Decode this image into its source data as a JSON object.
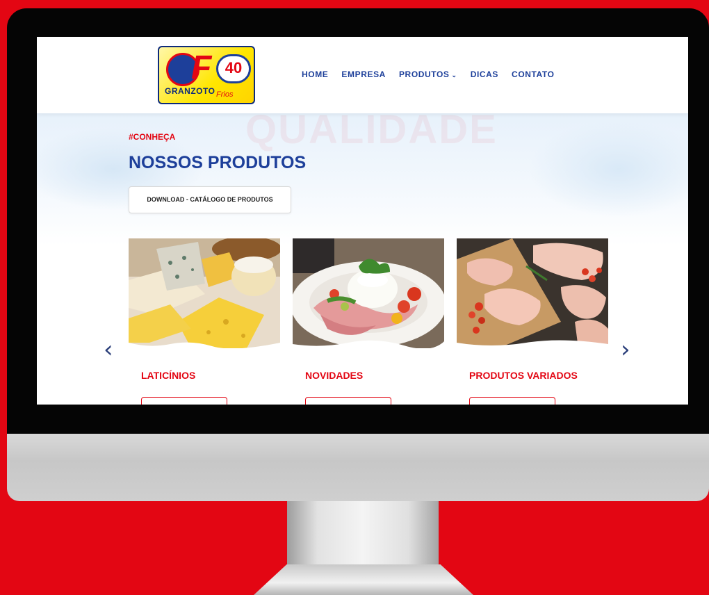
{
  "brand": {
    "logo_name": "GRANZOTO",
    "logo_sub": "Frios",
    "logo_number": "40",
    "logo_letter": "F"
  },
  "nav": {
    "items": [
      {
        "label": "HOME"
      },
      {
        "label": "EMPRESA"
      },
      {
        "label": "PRODUTOS",
        "has_dropdown": true,
        "chevron_icon": "chevron-down-icon"
      },
      {
        "label": "DICAS"
      },
      {
        "label": "CONTATO"
      }
    ]
  },
  "hero": {
    "watermark": "QUALIDADE",
    "eyebrow": "#CONHEÇA",
    "title": "NOSSOS PRODUTOS",
    "download_label": "DOWNLOAD - CATÁLOGO DE PRODUTOS"
  },
  "carousel": {
    "prev_icon": "chevron-left-icon",
    "next_icon": "chevron-right-icon",
    "cards": [
      {
        "title": "LATICÍNIOS",
        "image": "cheese-platter"
      },
      {
        "title": "NOVIDADES",
        "image": "burrata-salad"
      },
      {
        "title": "PRODUTOS VARIADOS",
        "image": "raw-chicken-board"
      }
    ]
  },
  "colors": {
    "accent_red": "#e30613",
    "brand_blue": "#1d3f9a",
    "background": "#e30613"
  }
}
